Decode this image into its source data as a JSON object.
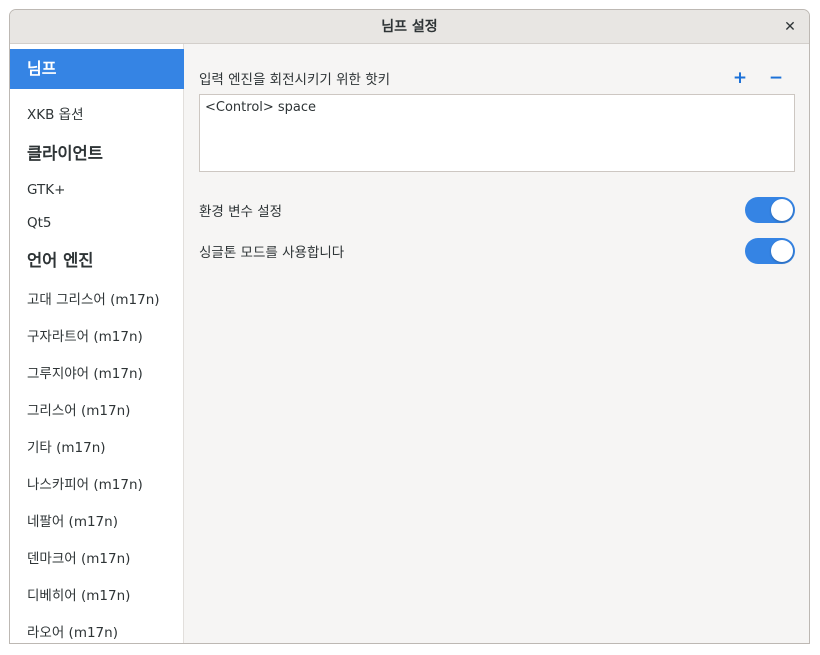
{
  "window": {
    "title": "님프 설정",
    "close_glyph": "✕"
  },
  "sidebar": {
    "items": [
      {
        "label": "님프",
        "kind": "selected"
      },
      {
        "label": "XKB 옵션",
        "kind": "item"
      },
      {
        "label": "클라이언트",
        "kind": "header"
      },
      {
        "label": "GTK+",
        "kind": "item"
      },
      {
        "label": "Qt5",
        "kind": "item"
      },
      {
        "label": "언어 엔진",
        "kind": "header"
      },
      {
        "label": "고대 그리스어 (m17n)",
        "kind": "item"
      },
      {
        "label": "구자라트어 (m17n)",
        "kind": "item"
      },
      {
        "label": "그루지야어 (m17n)",
        "kind": "item"
      },
      {
        "label": "그리스어 (m17n)",
        "kind": "item"
      },
      {
        "label": "기타 (m17n)",
        "kind": "item"
      },
      {
        "label": "나스카피어 (m17n)",
        "kind": "item"
      },
      {
        "label": "네팔어 (m17n)",
        "kind": "item"
      },
      {
        "label": "덴마크어 (m17n)",
        "kind": "item"
      },
      {
        "label": "디베히어 (m17n)",
        "kind": "item"
      },
      {
        "label": "라오어 (m17n)",
        "kind": "item"
      }
    ]
  },
  "main": {
    "hotkey_label": "입력 엔진을 회전시키기 위한 핫키",
    "add_glyph": "+",
    "remove_glyph": "−",
    "hotkeys": [
      "<Control> space"
    ],
    "env_label": "환경 변수 설정",
    "env_enabled": true,
    "singleton_label": "싱글톤 모드를 사용합니다",
    "singleton_enabled": true
  },
  "colors": {
    "accent": "#3584e4",
    "icon_blue": "#1c71d8"
  }
}
